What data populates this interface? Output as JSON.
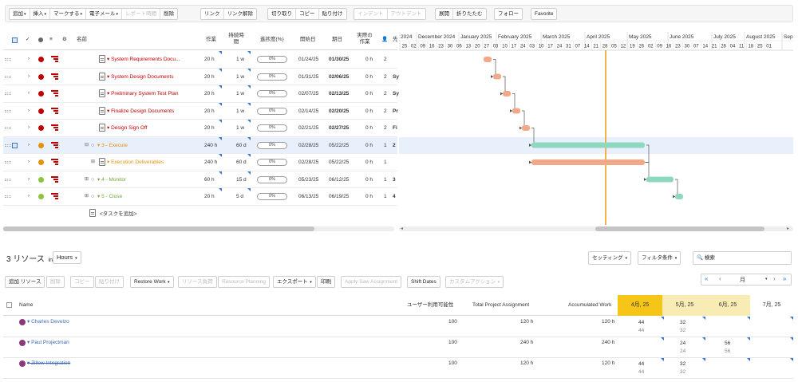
{
  "toolbar": {
    "groups": [
      [
        "追加",
        "挿入",
        "マークする",
        "電子メール",
        "レポート時間",
        "削除"
      ],
      [
        "リンク",
        "リンク解除"
      ],
      [
        "切り取り",
        "コピー",
        "貼り付け"
      ],
      [
        "インデント",
        "アウトデント"
      ],
      [
        "展開",
        "折りたたむ"
      ],
      [
        "フォロー"
      ],
      [
        "Favorite"
      ]
    ]
  },
  "grid": {
    "headers": {
      "name": "名前",
      "work": "作業",
      "duration": "持続時間",
      "progress": "進捗度(%)",
      "start": "開始日",
      "due": "期日",
      "actual_work": "実際の作業",
      "cut": "先"
    },
    "rows": [
      {
        "name": "System Requirements Docu...",
        "work": "20 h",
        "duration": "1 w",
        "progress": "0%",
        "start": "01/24/25",
        "due": "01/30/25",
        "actual": "0 h",
        "num": "2",
        "extra": "",
        "color": "#c00000",
        "level": "task"
      },
      {
        "name": "System Design Documents",
        "work": "20 h",
        "duration": "1 w",
        "progress": "0%",
        "start": "01/31/25",
        "due": "02/06/25",
        "actual": "0 h",
        "num": "2",
        "extra": "Sy",
        "color": "#c00000",
        "level": "task"
      },
      {
        "name": "Preliminary System Test Plan",
        "work": "20 h",
        "duration": "1 w",
        "progress": "0%",
        "start": "02/07/25",
        "due": "02/13/25",
        "actual": "0 h",
        "num": "2",
        "extra": "Sy",
        "color": "#c00000",
        "level": "task"
      },
      {
        "name": "Finalize Design Documents",
        "work": "20 h",
        "duration": "1 w",
        "progress": "0%",
        "start": "02/14/25",
        "due": "02/20/25",
        "actual": "0 h",
        "num": "2",
        "extra": "Pr",
        "color": "#c00000",
        "level": "task"
      },
      {
        "name": "Design Sign Off",
        "work": "20 h",
        "duration": "1 w",
        "progress": "0%",
        "start": "02/21/25",
        "due": "02/27/25",
        "actual": "0 h",
        "num": "2",
        "extra": "Fi",
        "color": "#c00000",
        "level": "task"
      },
      {
        "name": "3 - Execute",
        "work": "240 h",
        "duration": "60 d",
        "progress": "0%",
        "start": "02/28/25",
        "due": "05/22/25",
        "actual": "0 h",
        "num": "1",
        "extra": "2",
        "color": "#e8900c",
        "level": "phase"
      },
      {
        "name": "Execution Deliverables",
        "work": "240 h",
        "duration": "60 d",
        "progress": "0%",
        "start": "02/28/25",
        "due": "05/22/25",
        "actual": "0 h",
        "num": "1",
        "extra": "",
        "color": "#e8900c",
        "level": "sub"
      },
      {
        "name": "4 - Monitor",
        "work": "60 h",
        "duration": "15 d",
        "progress": "0%",
        "start": "05/23/25",
        "due": "06/12/25",
        "actual": "0 h",
        "num": "1",
        "extra": "3",
        "color": "#8cc43a",
        "level": "phase"
      },
      {
        "name": "5 - Close",
        "work": "20 h",
        "duration": "5 d",
        "progress": "0%",
        "start": "06/13/25",
        "due": "06/19/25",
        "actual": "0 h",
        "num": "1",
        "extra": "4",
        "color": "#8cc43a",
        "level": "phase"
      }
    ],
    "add_task": "<タスクを追加>"
  },
  "gantt": {
    "months": [
      "2024",
      "December 2024",
      "January 2025",
      "February 2025",
      "March 2025",
      "April 2025",
      "May 2025",
      "June 2025",
      "July 2025",
      "August 2025",
      "Sep"
    ],
    "weeks": [
      "25",
      "02",
      "09",
      "16",
      "23",
      "30",
      "06",
      "13",
      "20",
      "27",
      "03",
      "10",
      "17",
      "24",
      "03",
      "10",
      "17",
      "24",
      "31",
      "07",
      "14",
      "21",
      "28",
      "05",
      "12",
      "19",
      "26",
      "02",
      "09",
      "16",
      "23",
      "30",
      "07",
      "14",
      "21",
      "28",
      "04",
      "11",
      "18",
      "25",
      "01"
    ],
    "task_color": "#f2a98a",
    "phase_color": "#8fd8c0",
    "today_color": "#f0a020"
  },
  "resources": {
    "count_label": "3 リソース",
    "in_label": "in",
    "unit": "Hours",
    "settings": "セッティング",
    "filter": "フィルタ条件",
    "search_placeholder": "検索",
    "actions": [
      "追加 リソース",
      "削除",
      "コピー",
      "貼り付け",
      "Restore Work",
      "リソース負荷",
      "Resource Planning",
      "エクスポート",
      "印刷",
      "Apply Saw Assignment",
      "Shift Dates",
      "カスタムアクション"
    ],
    "period": "月",
    "headers": {
      "name": "Name",
      "availability": "ユーザー利用可能性",
      "total": "Total Project Assignment",
      "accum": "Accumulated Work",
      "months": [
        "4月, 25",
        "5月, 25",
        "6月, 25",
        "7月, 25"
      ]
    },
    "rows": [
      {
        "name": "Charles Develzo",
        "availability": "100",
        "total": "120 h",
        "accum": "120 h",
        "m": [
          [
            "44",
            "44"
          ],
          [
            "32",
            "32"
          ],
          [
            "",
            ""
          ],
          [
            "",
            ""
          ]
        ]
      },
      {
        "name": "Paul Projectman",
        "availability": "100",
        "total": "240 h",
        "accum": "240 h",
        "m": [
          [
            "",
            ""
          ],
          [
            "24",
            "24"
          ],
          [
            "56",
            "56"
          ],
          [
            "",
            ""
          ]
        ]
      },
      {
        "name": "Zillow Integration",
        "availability": "100",
        "total": "120 h",
        "accum": "120 h",
        "m": [
          [
            "44",
            "44"
          ],
          [
            "32",
            "32"
          ],
          [
            "",
            ""
          ],
          [
            "",
            ""
          ]
        ]
      }
    ]
  }
}
